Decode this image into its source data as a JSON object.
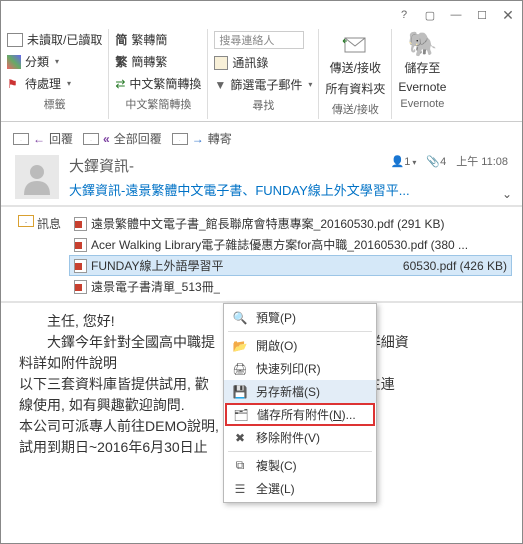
{
  "titlebar": {
    "help": "?",
    "collapse": "▢",
    "min": "—",
    "max": "☐",
    "close": "✕"
  },
  "ribbon": {
    "col1": {
      "btn1": "未讀取/已讀取",
      "btn2": "分類",
      "btn3": "待處理",
      "label": "標籤"
    },
    "col2": {
      "btn1": "繁轉簡",
      "btn2": "簡轉繁",
      "btn3": "中文繁簡轉換",
      "label": "中文繁簡轉換"
    },
    "col3": {
      "searchPlaceholder": "搜尋連絡人",
      "btn1": "通訊錄",
      "btn2": "篩選電子郵件",
      "label": "尋找"
    },
    "col4": {
      "line1": "傳送/接收",
      "line2": "所有資料夾",
      "label": "傳送/接收"
    },
    "col5": {
      "line1": "儲存至",
      "line2": "Evernote",
      "label": "Evernote"
    }
  },
  "actions": {
    "reply": "回覆",
    "replyAll": "全部回覆",
    "forward": "轉寄"
  },
  "header": {
    "sender": "大鐸資訊-",
    "subject": "大鐸資訊-遠景繁體中文電子書、FUNDAY線上外文學習平...",
    "count1": "1",
    "count2": "4",
    "time": "上午 11:08"
  },
  "attachments": {
    "label": "訊息",
    "items": [
      {
        "name": "遠景繁體中文電子書_館長聯席會特惠專案_20160530.pdf (291 KB)"
      },
      {
        "name": "Acer Walking Library電子雜誌優惠方案for高中職_20160530.pdf (380 ..."
      },
      {
        "name_left": "FUNDAY線上外語學習平",
        "name_right": "60530.pdf (426 KB)",
        "selected": true
      },
      {
        "name": "遠景電子書清單_513冊_"
      }
    ]
  },
  "ctx": {
    "preview": "預覽(P)",
    "open": "開啟(O)",
    "print": "快速列印(R)",
    "save": "另存新檔(S)",
    "saveall_a": "儲存所有附件(",
    "saveall_u": "N",
    "saveall_b": ")...",
    "remove": "移除附件(V)",
    "copy": "複製(C)",
    "selectall": "全選(L)"
  },
  "body": {
    "l1": "主任, 您好!",
    "l2": "大鐸今年針對全國高中職提",
    "l2b": "案, 詳細資",
    "l3": "料詳如附件說明",
    "l4": "以下三套資料庫皆提供試用, 歡",
    "l4b": "體師生連",
    "l5": "線使用, 如有興趣歡迎詢問.",
    "l6": "本公司可派專人前往DEMO說明,",
    "l7": "試用到期日~2016年6月30日止"
  }
}
